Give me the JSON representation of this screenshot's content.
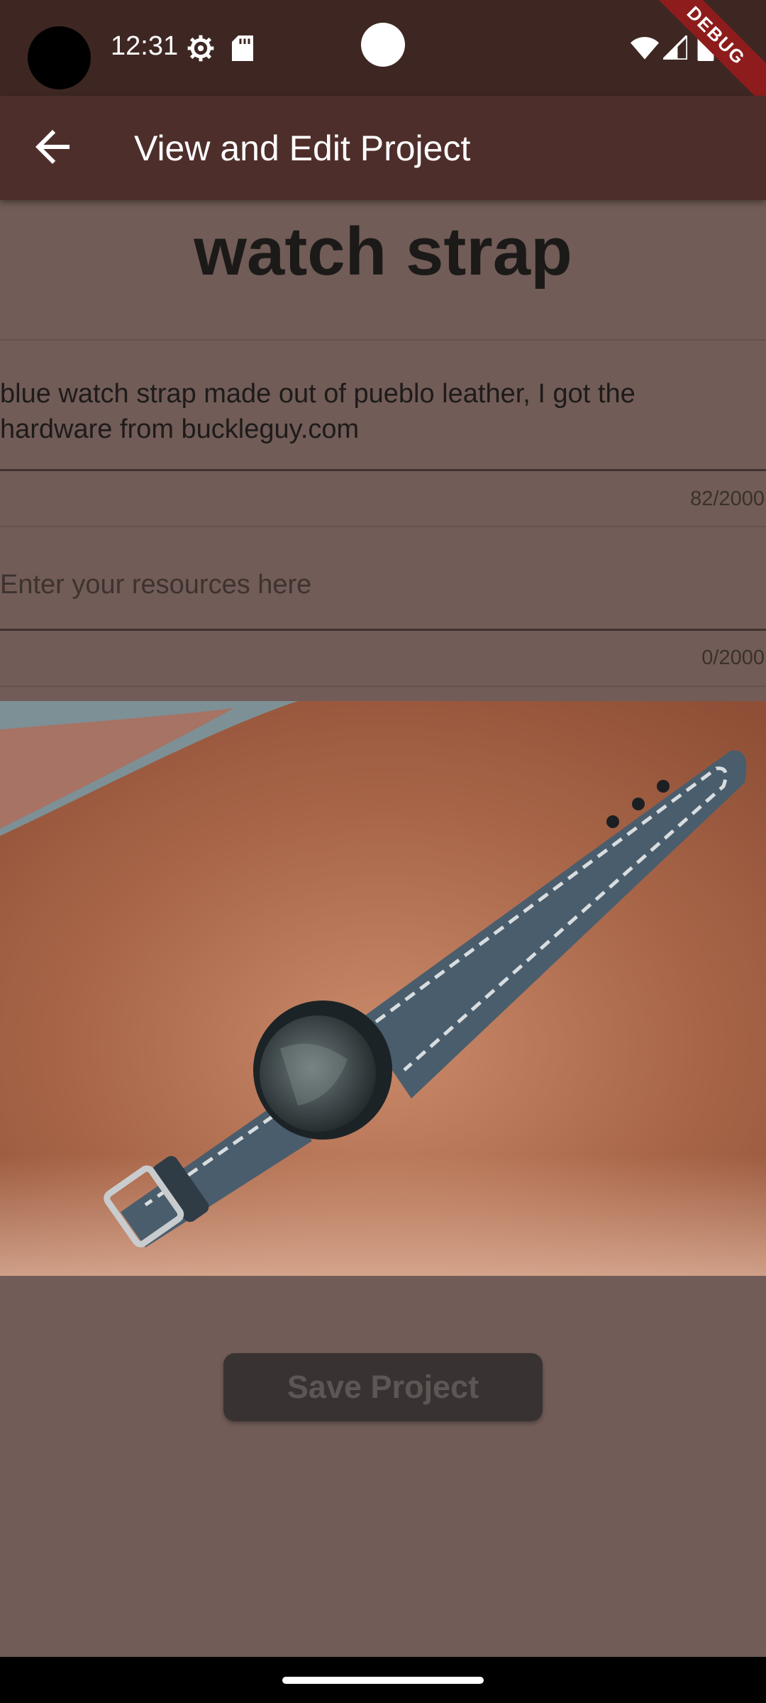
{
  "status_bar": {
    "time": "12:31",
    "icons": [
      "settings-gear-icon",
      "sd-card-icon",
      "wifi-icon",
      "signal-icon",
      "battery-icon"
    ],
    "debug_label": "DEBUG"
  },
  "app_bar": {
    "title": "View and Edit Project",
    "back_icon": "arrow-back-icon"
  },
  "project": {
    "title": "watch strap",
    "description": {
      "value": "blue watch strap made out of pueblo leather, I got the hardware from buckleguy.com",
      "counter": "82/2000"
    },
    "resources": {
      "value": "",
      "placeholder": "Enter your resources here",
      "counter": "0/2000"
    },
    "photo_icon": "watch-strap-photo"
  },
  "actions": {
    "save_label": "Save Project"
  },
  "colors": {
    "status_bar": "#3e2723",
    "app_bar": "#4e2e2b",
    "background": "#715c57",
    "debug_banner": "#8e1c1c",
    "button": "#383332"
  }
}
